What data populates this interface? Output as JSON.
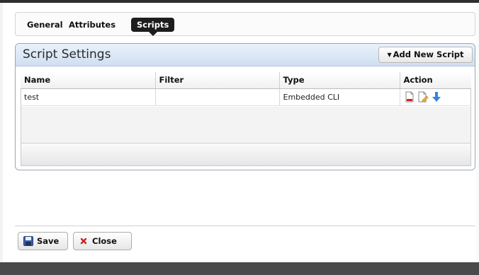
{
  "tabs": [
    {
      "label": "General"
    },
    {
      "label": "Attributes"
    },
    {
      "label": "Scripts",
      "active": true
    }
  ],
  "panel": {
    "title": "Script Settings",
    "add_button_label": "Add New Script",
    "columns": [
      "Name",
      "Filter",
      "Type",
      "Action"
    ],
    "rows": [
      {
        "name": "test",
        "filter": "",
        "type": "Embedded CLI",
        "actions": [
          "delete-document-icon",
          "edit-document-icon",
          "download-arrow-icon"
        ]
      }
    ]
  },
  "footer": {
    "save_label": "Save",
    "close_label": "Close"
  },
  "colors": {
    "active_tab": "#1d1d1d",
    "panel_header": "#cfdff1",
    "close_x": "#cc2222",
    "save_icon": "#3a5fa8",
    "arrow": "#2f86e0"
  }
}
